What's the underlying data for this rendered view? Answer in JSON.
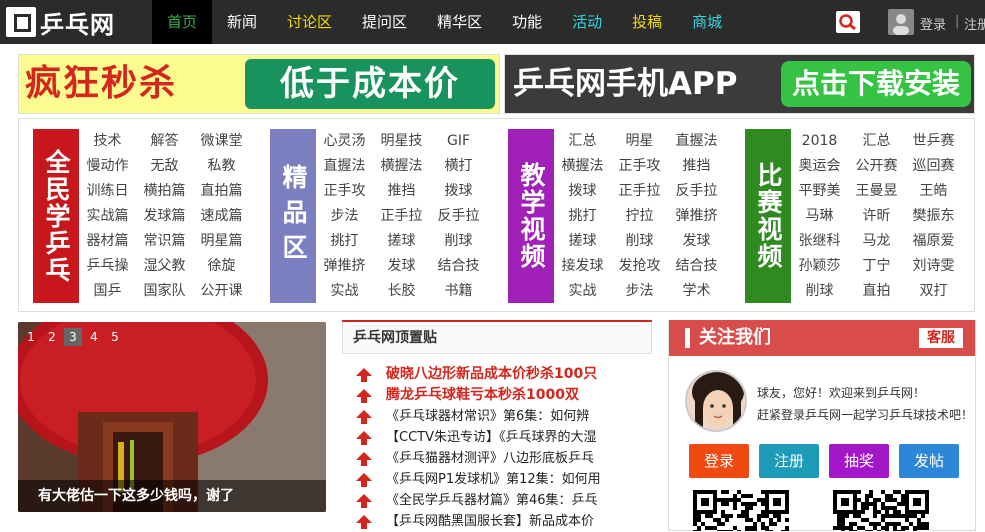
{
  "header": {
    "logo_text": "乒乓网",
    "nav": [
      {
        "label": "首页",
        "color": "#34b24a",
        "active": true
      },
      {
        "label": "新闻",
        "color": "#ffffff"
      },
      {
        "label": "讨论区",
        "color": "#f5d90a"
      },
      {
        "label": "提问区",
        "color": "#ffffff"
      },
      {
        "label": "精华区",
        "color": "#ffffff"
      },
      {
        "label": "功能",
        "color": "#ffffff"
      },
      {
        "label": "活动",
        "color": "#36d7e0"
      },
      {
        "label": "投稿",
        "color": "#f5d90a"
      },
      {
        "label": "商城",
        "color": "#36d7e0"
      }
    ],
    "search_icon": "search-icon",
    "login": "登录",
    "separator": "|",
    "register": "注册"
  },
  "banners": {
    "left_part1": "疯狂秒杀",
    "left_part2": "低于成本价",
    "right_part1": "乒乓网手机APP",
    "right_part2": "点击下载安装"
  },
  "categories": [
    {
      "label": "全民学乒乓",
      "color": "#c8161d",
      "links": [
        "技术",
        "解答",
        "微课堂",
        "慢动作",
        "无敌",
        "私教",
        "训练日",
        "横拍篇",
        "直拍篇",
        "实战篇",
        "发球篇",
        "速成篇",
        "器材篇",
        "常识篇",
        "明星篇",
        "乒乓操",
        "湿父教",
        "徐旋",
        "国乒",
        "国家队",
        "公开课"
      ]
    },
    {
      "label": "精品区",
      "color": "#7b7fc0",
      "links": [
        "心灵汤",
        "明星技",
        "GIF",
        "直握法",
        "横握法",
        "横打",
        "正手攻",
        "推挡",
        "拨球",
        "步法",
        "正手拉",
        "反手拉",
        "挑打",
        "搓球",
        "削球",
        "弹推挤",
        "发球",
        "结合技",
        "实战",
        "长胶",
        "书籍"
      ]
    },
    {
      "label": "教学视频",
      "color": "#a020b8",
      "links": [
        "汇总",
        "明星",
        "直握法",
        "横握法",
        "正手攻",
        "推挡",
        "拨球",
        "正手拉",
        "反手拉",
        "挑打",
        "拧拉",
        "弹推挤",
        "搓球",
        "削球",
        "发球",
        "接发球",
        "发抢攻",
        "结合技",
        "实战",
        "步法",
        "学术"
      ]
    },
    {
      "label": "比赛视频",
      "color": "#2f8a1f",
      "links": [
        "2018",
        "汇总",
        "世乒赛",
        "奥运会",
        "公开赛",
        "巡回赛",
        "平野美",
        "王曼昱",
        "王皓",
        "马琳",
        "许昕",
        "樊振东",
        "张继科",
        "马龙",
        "福原爱",
        "孙颖莎",
        "丁宁",
        "刘诗雯",
        "削球",
        "直拍",
        "双打"
      ]
    }
  ],
  "slider": {
    "dots": [
      "1",
      "2",
      "3",
      "4",
      "5"
    ],
    "active_dot": 3,
    "caption": "有大佬估一下这多少钱吗，谢了"
  },
  "pinned": {
    "title": "乒乓网顶置贴",
    "items": [
      {
        "text": "破晓八边形新品成本价秒杀100只",
        "hot": true
      },
      {
        "text": "腾龙乒乓球鞋亏本秒杀1000双",
        "hot": true
      },
      {
        "text": "《乒乓球器材常识》第6集：如何辨",
        "hot": false
      },
      {
        "text": "【CCTV朱迅专访】《乒乓球界的大湿",
        "hot": false
      },
      {
        "text": "《乒乓猫器材测评》八边形底板乒乓",
        "hot": false
      },
      {
        "text": "《乒乓网P1发球机》第12集：如何用",
        "hot": false
      },
      {
        "text": "《全民学乒乓器材篇》第46集：乒乓",
        "hot": false
      },
      {
        "text": "【乒乓网酷黑国服长套】新品成本价",
        "hot": false
      }
    ]
  },
  "follow": {
    "title": "关注我们",
    "service": "客服",
    "greeting": "球友，您好！欢迎来到乒乓网！",
    "invite": "赶紧登录乒乓网一起学习乒乓球技术吧！",
    "buttons": [
      {
        "label": "登录",
        "color": "#f04a12"
      },
      {
        "label": "注册",
        "color": "#1e9bb8"
      },
      {
        "label": "抽奖",
        "color": "#a317c8"
      },
      {
        "label": "发帖",
        "color": "#2d87d9"
      }
    ]
  }
}
